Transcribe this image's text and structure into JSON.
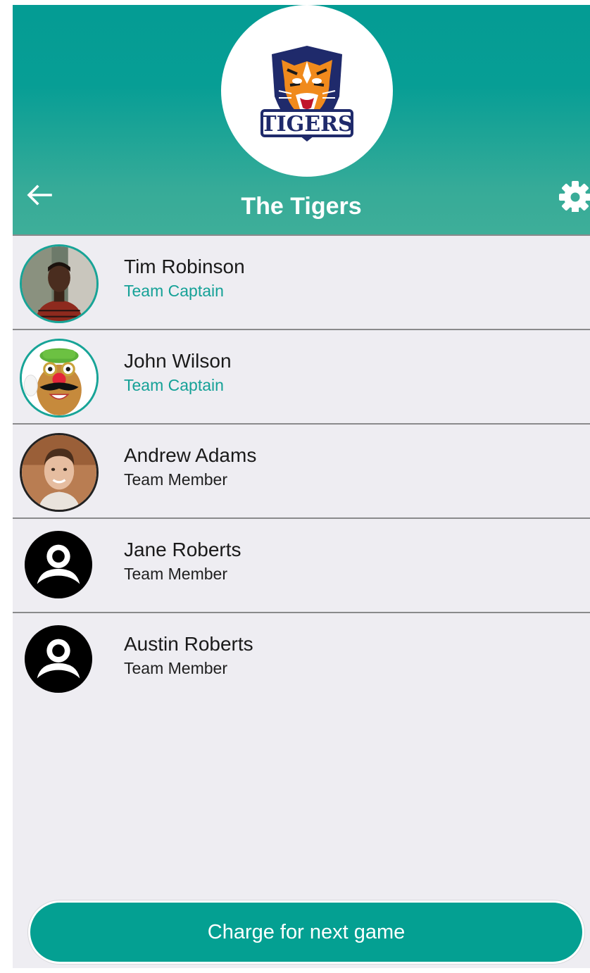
{
  "header": {
    "title": "The Tigers",
    "logo_text": "TIGERS",
    "back_icon": "arrow-left-icon",
    "settings_icon": "gear-icon"
  },
  "colors": {
    "header_top": "#049c94",
    "header_bottom": "#3eae99",
    "accent": "#15a197",
    "list_background": "#eeedf2",
    "button": "#04a092"
  },
  "members": [
    {
      "name": "Tim Robinson",
      "role": "Team Captain",
      "avatar": "photo"
    },
    {
      "name": "John Wilson",
      "role": "Team Captain",
      "avatar": "photo"
    },
    {
      "name": "Andrew Adams",
      "role": "Team Member",
      "avatar": "photo"
    },
    {
      "name": "Jane Roberts",
      "role": "Team Member",
      "avatar": "generic-user-icon"
    },
    {
      "name": "Austin Roberts",
      "role": "Team Member",
      "avatar": "generic-user-icon"
    }
  ],
  "footer": {
    "charge_button_label": "Charge for next game"
  }
}
